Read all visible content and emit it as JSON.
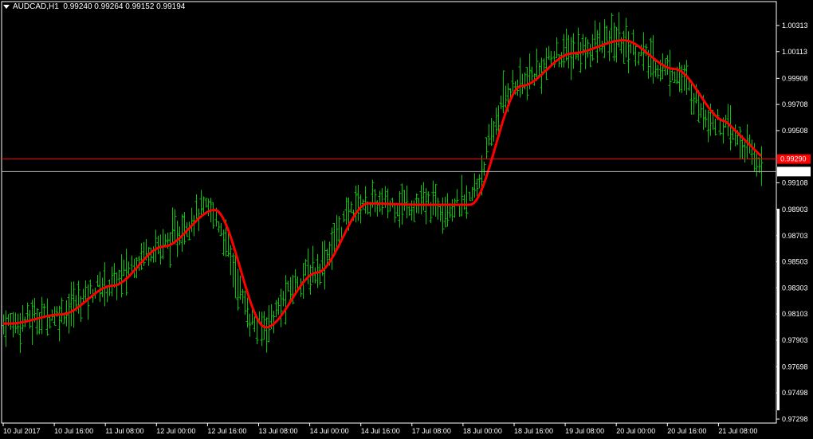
{
  "header": {
    "symbol": "AUDCAD,H1",
    "open": "0.99240",
    "high": "0.99264",
    "low": "0.99152",
    "close": "0.99194"
  },
  "colors": {
    "background": "#000000",
    "bars": "#00c800",
    "ma_line": "#ff0000",
    "ask_line": "#ff0000",
    "bid_line": "#c0c0c0",
    "axis": "#ffffff"
  },
  "price_axis": {
    "labels": [
      "1.00313",
      "1.00113",
      "0.99908",
      "0.99708",
      "0.99508",
      "0.99108",
      "0.98903",
      "0.98703",
      "0.98503",
      "0.98303",
      "0.98103",
      "0.97903",
      "0.97698",
      "0.97498",
      "0.97298"
    ],
    "ask_label": "0.99290",
    "bid_label": "0.99194"
  },
  "time_axis": {
    "labels": [
      "10 Jul 2017",
      "10 Jul 16:00",
      "11 Jul 08:00",
      "12 Jul 00:00",
      "12 Jul 16:00",
      "13 Jul 08:00",
      "14 Jul 00:00",
      "14 Jul 16:00",
      "17 Jul 08:00",
      "18 Jul 00:00",
      "18 Jul 16:00",
      "19 Jul 08:00",
      "20 Jul 00:00",
      "20 Jul 16:00",
      "21 Jul 08:00"
    ]
  },
  "chart_data": {
    "type": "line",
    "title": "AUDCAD,H1",
    "ylim": [
      0.97298,
      1.00413
    ],
    "x": [
      "10 Jul 2017",
      "10 Jul 16:00",
      "11 Jul 08:00",
      "12 Jul 00:00",
      "12 Jul 16:00",
      "13 Jul 08:00",
      "14 Jul 00:00",
      "14 Jul 16:00",
      "17 Jul 08:00",
      "18 Jul 00:00",
      "18 Jul 16:00",
      "19 Jul 08:00",
      "20 Jul 00:00",
      "20 Jul 16:00",
      "21 Jul 08:00"
    ],
    "series": [
      {
        "values": [
          0.9803,
          0.981,
          0.9832,
          0.9862,
          0.989,
          0.98,
          0.9842,
          0.9895,
          0.9894,
          0.9894,
          0.9985,
          1.001,
          1.002,
          0.9998,
          0.9958
        ]
      }
    ],
    "ask": 0.9929,
    "bid": 0.99194
  }
}
